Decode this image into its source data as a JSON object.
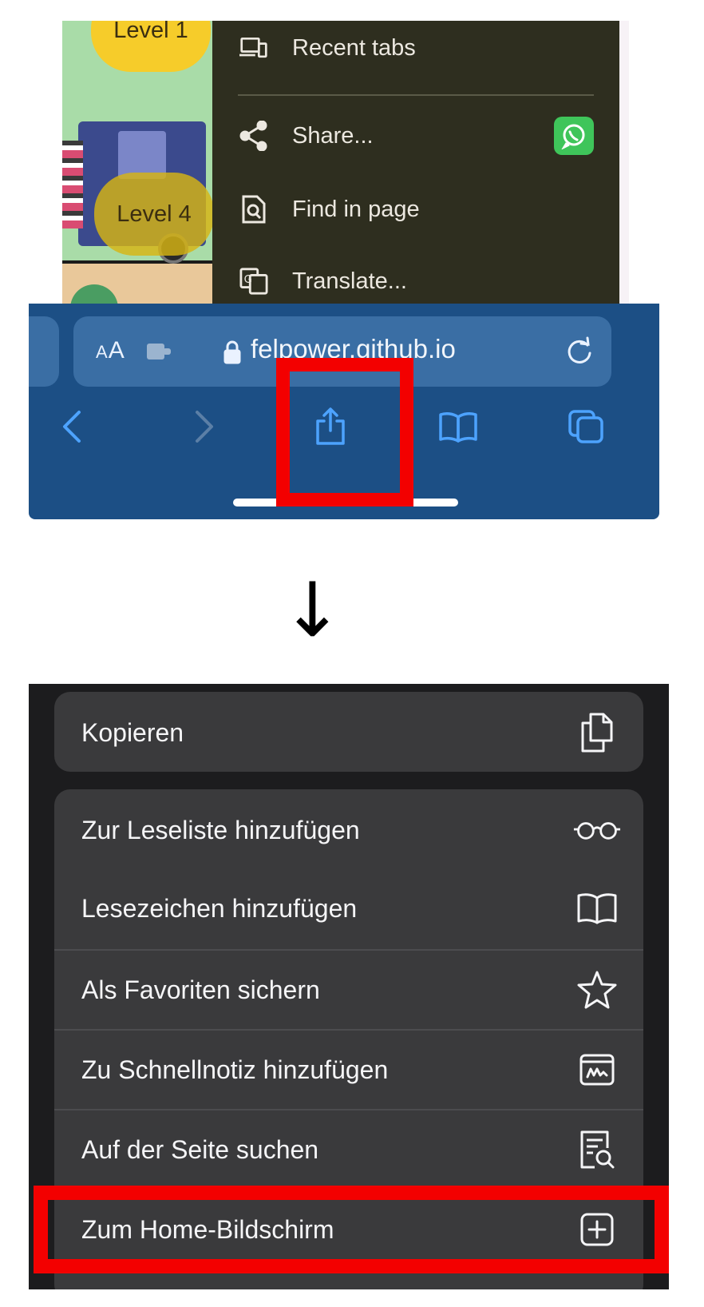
{
  "overflow_menu": {
    "recent_tabs": "Recent tabs",
    "share": "Share...",
    "find_in_page": "Find in page",
    "translate": "Translate..."
  },
  "game": {
    "level_1": "Level 1",
    "level_4": "Level 4"
  },
  "safari": {
    "aa_small": "A",
    "aa_large": "A",
    "url": "felpower.github.io",
    "colors": {
      "toolbar": "#1c4f85",
      "field": "#3a6ea4",
      "icon": "#4da3ff",
      "highlight": "#f30000"
    }
  },
  "arrow": "↓",
  "share_sheet": {
    "copy_label": "Kopieren",
    "actions": [
      {
        "label": "Zur Leseliste hinzufügen",
        "icon": "glasses-icon"
      },
      {
        "label": "Lesezeichen hinzufügen",
        "icon": "book-icon"
      },
      {
        "label": "Als Favoriten sichern",
        "icon": "star-icon"
      },
      {
        "label": "Zu Schnellnotiz hinzufügen",
        "icon": "quick-note-icon"
      },
      {
        "label": "Auf der Seite suchen",
        "icon": "search-document-icon"
      },
      {
        "label": "Zum Home-Bildschirm",
        "icon": "add-square-icon"
      }
    ]
  }
}
